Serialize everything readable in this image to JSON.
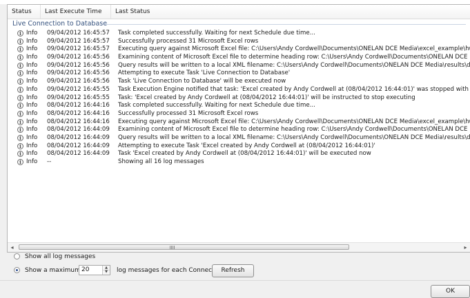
{
  "columns": {
    "status": "Status",
    "time": "Last Execute Time",
    "message": "Last Status"
  },
  "group_label": "Live Connection to Database",
  "icon": "info-icon",
  "rows": [
    {
      "status": "Info",
      "time": "09/04/2012 16:45:57",
      "message": "Task completed successfully.  Waiting for next Schedule due time..."
    },
    {
      "status": "Info",
      "time": "09/04/2012 16:45:57",
      "message": "Successfully processed 31 Microsoft Excel rows"
    },
    {
      "status": "Info",
      "time": "09/04/2012 16:45:57",
      "message": "Executing query against Microsoft Excel file: C:\\Users\\Andy Cordwell\\Documents\\ONELAN DCE Media\\excel_example\\huntley_sales.x"
    },
    {
      "status": "Info",
      "time": "09/04/2012 16:45:56",
      "message": "Examining content of Microsoft Excel file to determine heading row: C:\\Users\\Andy Cordwell\\Documents\\ONELAN DCE Media\\excel_e"
    },
    {
      "status": "Info",
      "time": "09/04/2012 16:45:56",
      "message": "Query results will be written to a local XML filename: C:\\Users\\Andy Cordwell\\Documents\\ONELAN DCE Media\\results\\data.xml"
    },
    {
      "status": "Info",
      "time": "09/04/2012 16:45:56",
      "message": "Attempting to execute Task 'Live Connection to Database'"
    },
    {
      "status": "Info",
      "time": "09/04/2012 16:45:56",
      "message": "Task 'Live Connection to Database' will be executed now"
    },
    {
      "status": "Info",
      "time": "09/04/2012 16:45:55",
      "message": "Task Execution Engine notified that task: 'Excel created by Andy Cordwell at (08/04/2012 16:44:01)' was stopped with status: Stopped"
    },
    {
      "status": "Info",
      "time": "09/04/2012 16:45:55",
      "message": "Task: 'Excel created by Andy Cordwell at (08/04/2012 16:44:01)' will be instructed to stop executing"
    },
    {
      "status": "Info",
      "time": "08/04/2012 16:44:16",
      "message": "Task completed successfully.  Waiting for next Schedule due time..."
    },
    {
      "status": "Info",
      "time": "08/04/2012 16:44:16",
      "message": "Successfully processed 31 Microsoft Excel rows"
    },
    {
      "status": "Info",
      "time": "08/04/2012 16:44:16",
      "message": "Executing query against Microsoft Excel file: C:\\Users\\Andy Cordwell\\Documents\\ONELAN DCE Media\\excel_example\\huntley_sales.x"
    },
    {
      "status": "Info",
      "time": "08/04/2012 16:44:09",
      "message": "Examining content of Microsoft Excel file to determine heading row: C:\\Users\\Andy Cordwell\\Documents\\ONELAN DCE Media\\excel_e"
    },
    {
      "status": "Info",
      "time": "08/04/2012 16:44:09",
      "message": "Query results will be written to a local XML filename: C:\\Users\\Andy Cordwell\\Documents\\ONELAN DCE Media\\results\\data.xml"
    },
    {
      "status": "Info",
      "time": "08/04/2012 16:44:09",
      "message": "Attempting to execute Task 'Excel created by Andy Cordwell at (08/04/2012 16:44:01)'"
    },
    {
      "status": "Info",
      "time": "08/04/2012 16:44:09",
      "message": "Task 'Excel created by Andy Cordwell at (08/04/2012 16:44:01)' will be executed now"
    },
    {
      "status": "Info",
      "time": "--",
      "message": "Showing all 16 log messages"
    }
  ],
  "scroll_grip": "III",
  "options": {
    "show_all_label": "Show all log messages",
    "show_all_selected": false,
    "show_max_label": "Show a maximum of",
    "show_max_selected": true,
    "max_value": "20",
    "suffix_label": "log messages for each Connection"
  },
  "buttons": {
    "refresh": "Refresh",
    "ok": "OK"
  }
}
